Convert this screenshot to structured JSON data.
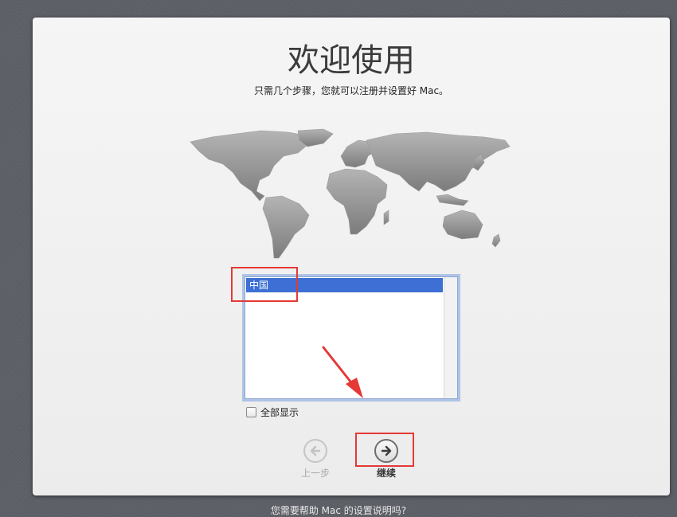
{
  "welcome": {
    "title": "欢迎使用",
    "subtitle": "只需几个步骤，您就可以注册并设置好 Mac。"
  },
  "country_list": {
    "items": [
      "中国"
    ],
    "selected": "中国"
  },
  "show_all": {
    "label": "全部显示",
    "checked": false
  },
  "navigation": {
    "back_label": "上一步",
    "continue_label": "继续"
  },
  "footer": {
    "text": "您需要帮助 Mac 的设置说明吗?"
  },
  "colors": {
    "selection": "#3d6fd4",
    "annotation": "#e53935",
    "panel": "#f0f0f0"
  }
}
